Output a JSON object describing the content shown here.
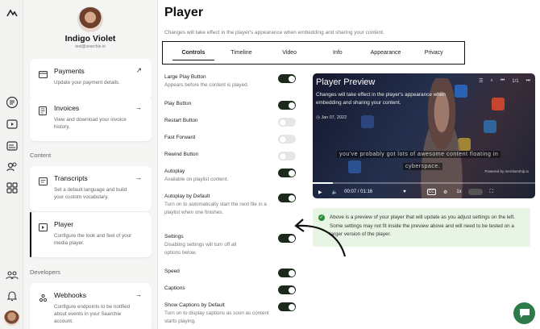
{
  "rail": {
    "icons": [
      "logo-icon",
      "questions-icon",
      "media-icon",
      "captions-icon",
      "users-icon",
      "apps-icon",
      "group-icon",
      "notifications-icon"
    ]
  },
  "profile": {
    "name": "Indigo Violet",
    "email": "test@searchie.io"
  },
  "sections": {
    "content": "Content",
    "developers": "Developers"
  },
  "cards": [
    {
      "title": "Payments",
      "desc": "Update your payment details.",
      "arrow": "↗"
    },
    {
      "title": "Invoices",
      "desc": "View and download your invoice history.",
      "arrow": "→"
    },
    {
      "title": "Transcripts",
      "desc": "Set a default language and build your custom vocabulary.",
      "arrow": "→"
    },
    {
      "title": "Player",
      "desc": "Configure the look and feel of your media player.",
      "arrow": ""
    },
    {
      "title": "Webhooks",
      "desc": "Configure endpoints to be notified about events in your Searchie account.",
      "arrow": "→"
    }
  ],
  "page": {
    "title": "Player",
    "subtitle": "Changes will take effect in the player's appearance when embedding and sharing your content."
  },
  "tabs": [
    "Controls",
    "Timeline",
    "Video",
    "Info",
    "Appearance",
    "Privacy"
  ],
  "settings": [
    {
      "label": "Large Play Button",
      "desc": "Appears before the content is played.",
      "on": true
    },
    {
      "label": "Play Button",
      "desc": "",
      "on": true
    },
    {
      "label": "Restart Button",
      "desc": "",
      "on": false
    },
    {
      "label": "Fast Forward",
      "desc": "",
      "on": false
    },
    {
      "label": "Rewind Button",
      "desc": "",
      "on": false
    },
    {
      "label": "Autoplay",
      "desc": "Available on playlist content.",
      "on": true
    },
    {
      "label": "Autoplay by Default",
      "desc": "Turn on to automatically start the next file in a playlist when one finishes.",
      "on": true
    },
    {
      "label": "Settings",
      "desc": "Disabling settings will turn off all options below.",
      "on": true
    },
    {
      "label": "Speed",
      "desc": "",
      "on": true
    },
    {
      "label": "Captions",
      "desc": "",
      "on": true
    },
    {
      "label": "Show Captions by Default",
      "desc": "Turn on to display captions as soon as content starts playing.",
      "on": true
    }
  ],
  "preview": {
    "title": "Player Preview",
    "playlist_count": "1/1",
    "desc": "Changes will take effect in the player's appearance when embedding and sharing your content.",
    "date": "Jan 07, 2022",
    "subtitle_line1": "you've probably got lots of awesome content floating in",
    "subtitle_line2": "cyberspace.",
    "powered": "Powered by membership.io",
    "time": "00:07 / 01:16",
    "speed": "1x",
    "progress": 0.09
  },
  "note": "Above is a preview of your player that will update as you adjust settings on the left. Some settings may not fit inside the preview above and will need to be tested on a larger version of the player.",
  "colors": {
    "toggle_on": "#1c2a1c",
    "toggle_off": "#e6e6e6",
    "note_bg": "#e8f4e4",
    "chat": "#2d7b4a"
  }
}
